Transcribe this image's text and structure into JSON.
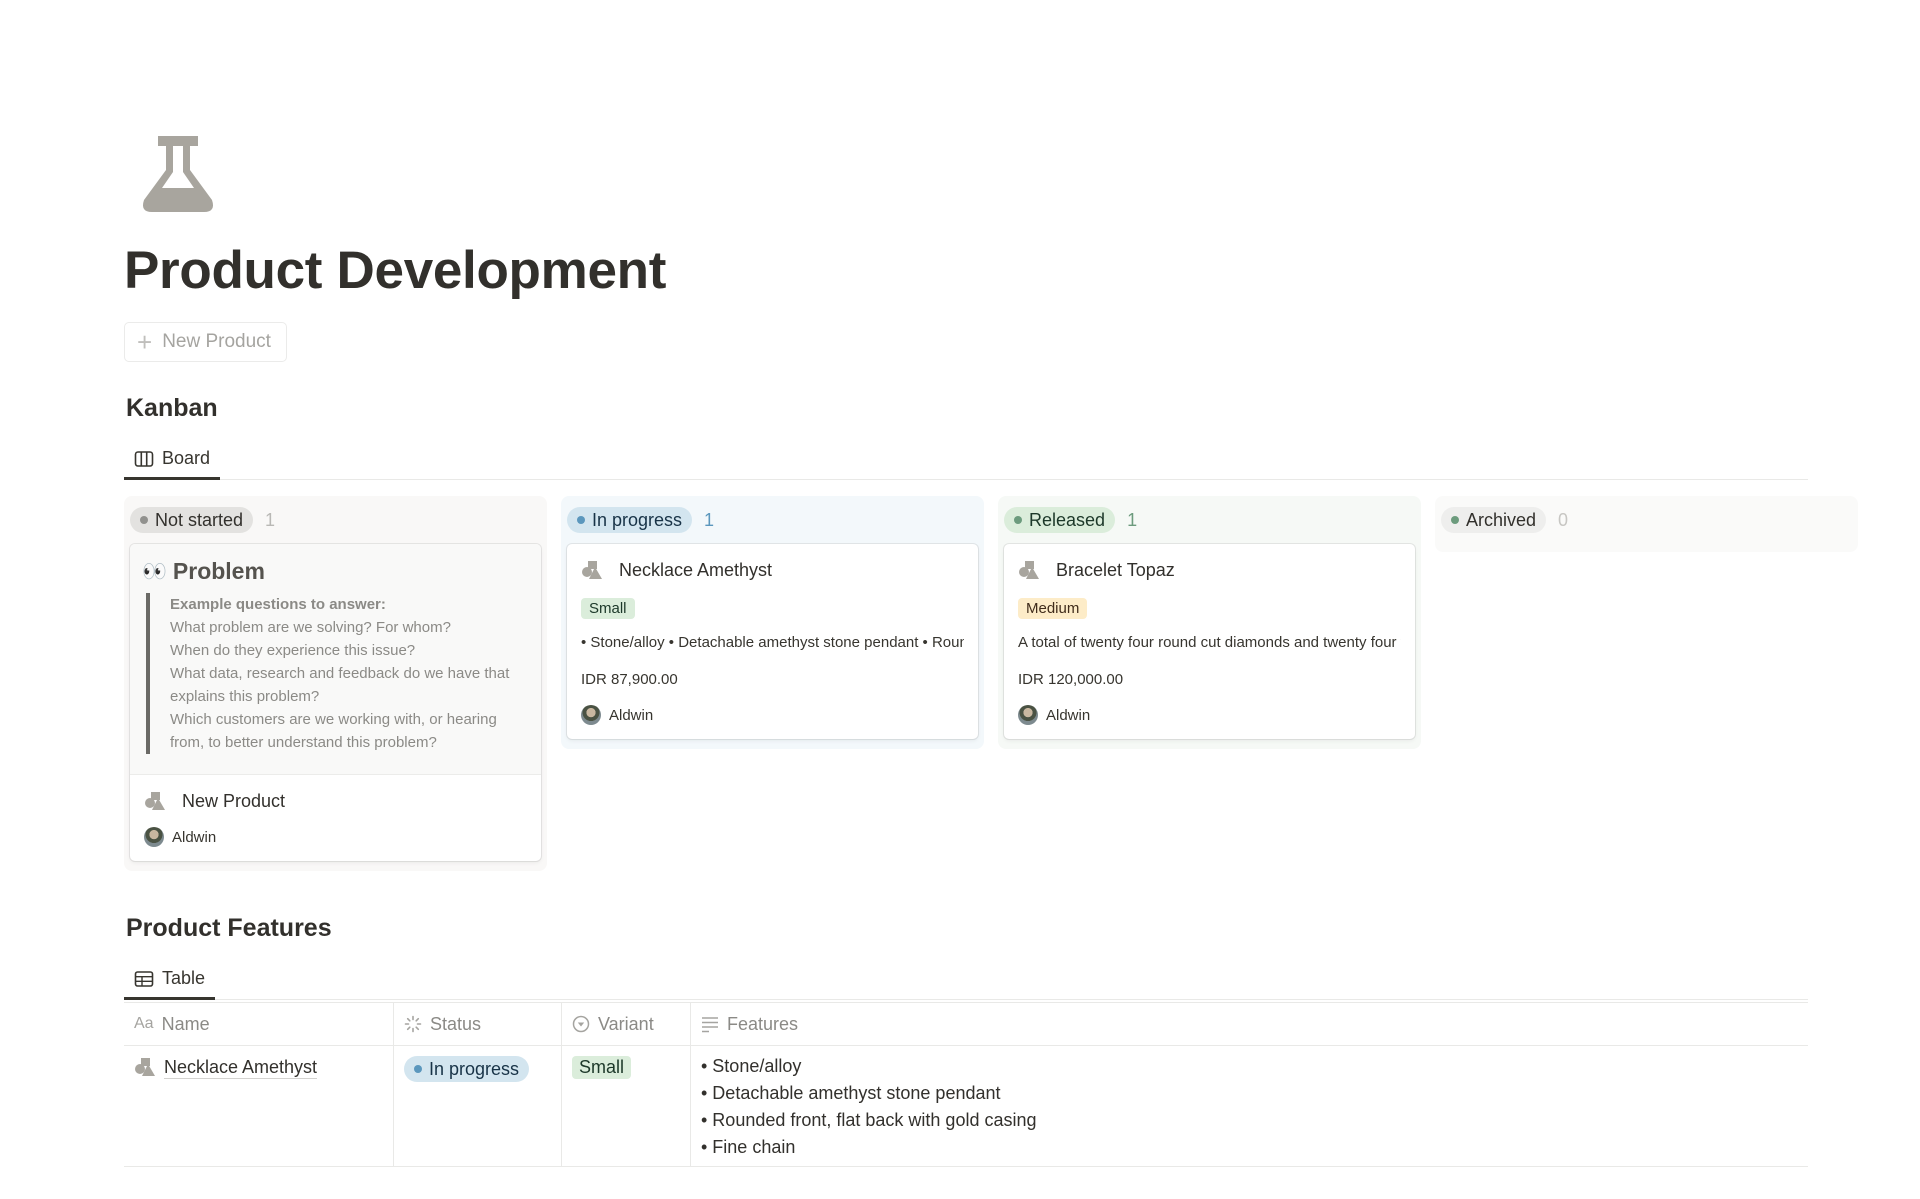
{
  "page": {
    "icon": "flask-icon",
    "title": "Product Development",
    "new_button_label": "New Product"
  },
  "kanban": {
    "title": "Kanban",
    "view_tab": "Board",
    "columns": [
      {
        "status": "Not started",
        "count": "1",
        "colors": {
          "bg": "#f9f8f7",
          "pill": "#e3e2e0",
          "dot": "#91918e",
          "text": "#32302c",
          "count": "#b9b8b5"
        },
        "cards": [
          {
            "preview": {
              "emoji": "👀",
              "heading": "Problem",
              "quote_heading": "Example questions to answer:",
              "quote_lines": [
                "What problem are we solving? For whom?",
                "When do they experience this issue?",
                "What data, research and feedback do we have that explains this problem?",
                "Which customers are we working with, or hearing from, to better understand this problem?"
              ]
            },
            "title": "New Product",
            "person": "Aldwin"
          }
        ]
      },
      {
        "status": "In progress",
        "count": "1",
        "colors": {
          "bg": "#f3f8fb",
          "pill": "#d3e5ef",
          "dot": "#5b97bd",
          "text": "#183347",
          "count": "#5b97bd"
        },
        "cards": [
          {
            "title": "Necklace Amethyst",
            "variant": "Small",
            "variant_colors": {
              "bg": "#dbeddb",
              "text": "#1c3829"
            },
            "features": "• Stone/alloy • Detachable amethyst stone pendant • Rounded front, flat back with gold casing • Fine chain",
            "price": "IDR 87,900.00",
            "person": "Aldwin"
          }
        ]
      },
      {
        "status": "Released",
        "count": "1",
        "colors": {
          "bg": "#f6f9f6",
          "pill": "#dbeddb",
          "dot": "#6c9b7d",
          "text": "#1c3829",
          "count": "#6c9b7d"
        },
        "cards": [
          {
            "title": "Bracelet Topaz",
            "variant": "Medium",
            "variant_colors": {
              "bg": "#fdecc8",
              "text": "#402c1b"
            },
            "features": "A total of twenty four round cut diamonds and twenty four topaz stones",
            "price": "IDR 120,000.00",
            "person": "Aldwin"
          }
        ]
      },
      {
        "status": "Archived",
        "count": "0",
        "colors": {
          "bg": "#fafaf9",
          "pill": "#eeeeed",
          "dot": "#6c9b7d",
          "text": "#32302c",
          "count": "#c7c6c3"
        },
        "cards": []
      }
    ]
  },
  "features_table": {
    "title": "Product Features",
    "view_tab": "Table",
    "columns": [
      {
        "label": "Name",
        "icon": "text-type-icon"
      },
      {
        "label": "Status",
        "icon": "status-spinner-icon"
      },
      {
        "label": "Variant",
        "icon": "select-icon"
      },
      {
        "label": "Features",
        "icon": "text-lines-icon"
      }
    ],
    "rows": [
      {
        "name": "Necklace Amethyst",
        "status": "In progress",
        "variant": "Small",
        "features": [
          "• Stone/alloy",
          "• Detachable amethyst stone pendant",
          "• Rounded front, flat back with gold casing",
          "• Fine chain"
        ]
      }
    ]
  }
}
